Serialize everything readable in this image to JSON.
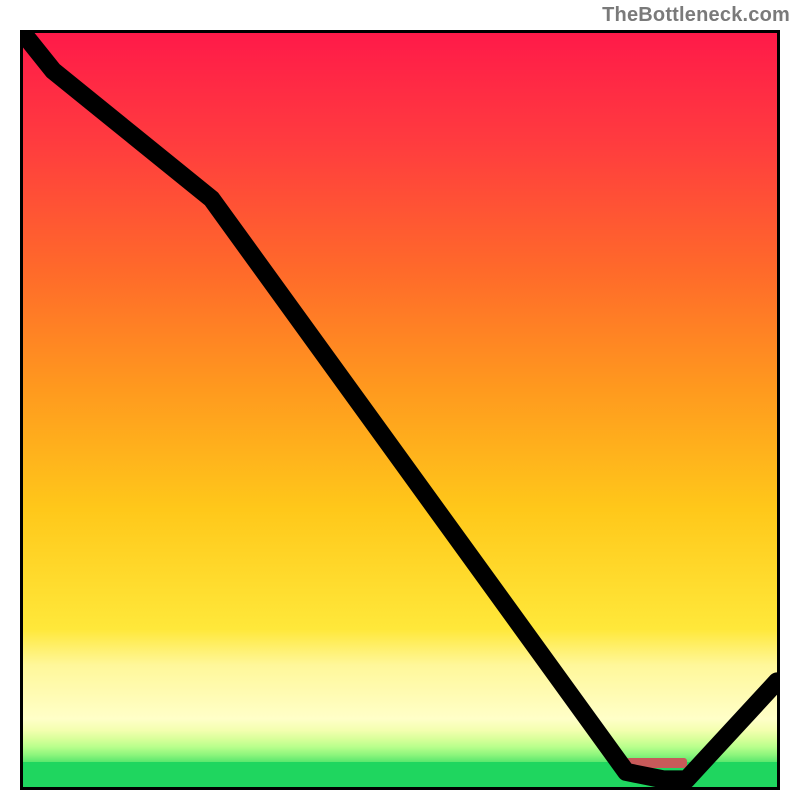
{
  "watermark": "TheBottleneck.com",
  "chart_data": {
    "type": "line",
    "x": [
      0,
      4,
      25,
      80,
      85,
      88,
      100
    ],
    "values": [
      100,
      95,
      78,
      2,
      1,
      1,
      14
    ],
    "title": "",
    "xlabel": "",
    "ylabel": "",
    "xlim": [
      0,
      100
    ],
    "ylim": [
      0,
      100
    ],
    "marker": {
      "x_start": 80,
      "x_end": 88,
      "y": 1
    },
    "background": {
      "description": "vertical red-to-yellow gradient with pale-yellow and green bands near bottom, solid green strip at base",
      "colors_top_to_bottom": [
        "#ff1a49",
        "#ff6a2a",
        "#ffc81a",
        "#ffe83a",
        "#ffffc8",
        "#8cf57c",
        "#1fd65f"
      ]
    }
  },
  "plot": {
    "marker_left_pct": 80,
    "marker_width_pct": 8,
    "marker_top_pct": 96.2
  }
}
